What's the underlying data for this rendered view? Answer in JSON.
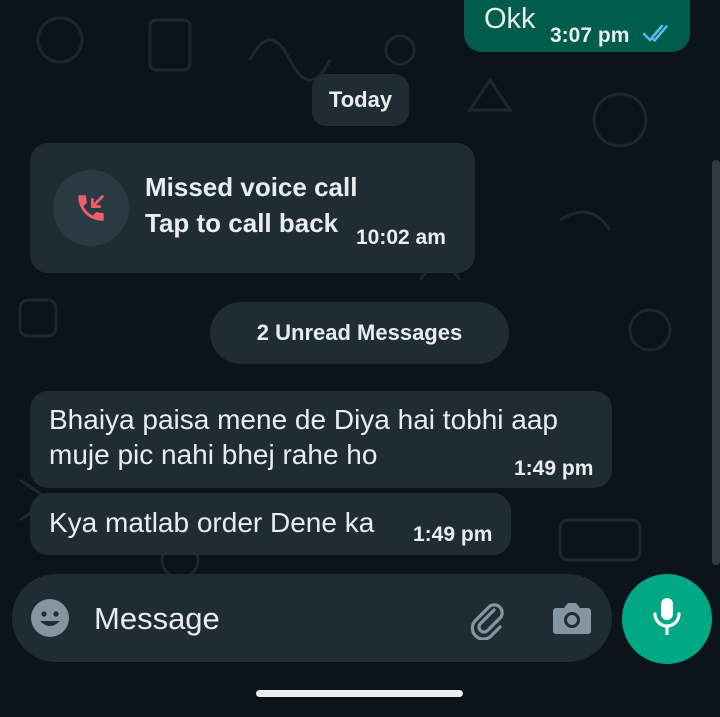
{
  "messages": {
    "outgoing_last": {
      "text": "Okk",
      "time": "3:07 pm",
      "status": "read",
      "status_icon": "double-check-icon"
    },
    "date_divider": "Today",
    "missed_call": {
      "title": "Missed voice call",
      "subtitle": "Tap to call back",
      "time": "10:02 am",
      "icon": "missed-call-icon"
    },
    "unread_divider": "2 Unread Messages",
    "incoming": [
      {
        "lines": [
          "Bhaiya paisa mene de Diya hai tobhi aap",
          "muje pic nahi bhej rahe ho"
        ],
        "time": "1:49 pm"
      },
      {
        "lines": [
          "Kya matlab order Dene ka"
        ],
        "time": "1:49 pm"
      }
    ]
  },
  "composer": {
    "placeholder": "Message",
    "emoji_icon": "emoji-icon",
    "attach_icon": "paperclip-icon",
    "camera_icon": "camera-icon",
    "mic_icon": "microphone-icon"
  },
  "colors": {
    "background": "#0b141a",
    "incoming_bubble": "#1f2c34",
    "outgoing_bubble": "#005c4b",
    "accent": "#00a884",
    "missed_call_red": "#f15c6d",
    "read_ticks": "#53bdeb"
  }
}
